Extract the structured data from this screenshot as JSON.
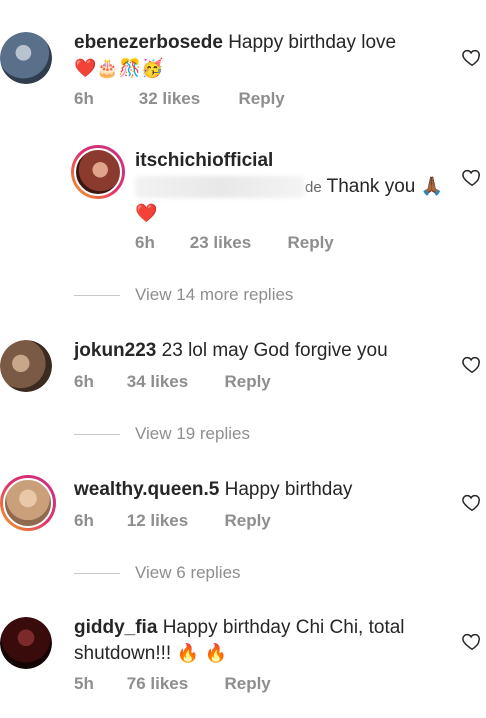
{
  "comments": [
    {
      "username": "ebenezerbosede",
      "text": "Happy birthday love",
      "emojis": "❤️🎂🎊🥳",
      "time": "6h",
      "likes": "32 likes",
      "reply": "Reply",
      "avatar_color": "#5a6f8a"
    },
    {
      "username": "itschichiofficial",
      "text_prefix": "de",
      "text": "Thank you",
      "emoji_inline": "🙏🏾",
      "emoji_line2": "❤️",
      "time": "6h",
      "likes": "23 likes",
      "reply": "Reply",
      "avatar_color": "#8a3b2e"
    },
    {
      "username": "jokun223",
      "text": "23 lol may God forgive you",
      "time": "6h",
      "likes": "34 likes",
      "reply": "Reply",
      "avatar_color": "#7a5a44"
    },
    {
      "username": "wealthy.queen.5",
      "text": "Happy birthday",
      "time": "6h",
      "likes": "12 likes",
      "reply": "Reply",
      "avatar_color": "#c9a07a"
    },
    {
      "username": "giddy_fia",
      "text": "Happy birthday Chi Chi, total shutdown!!!",
      "emojis": "🔥 🔥",
      "time": "5h",
      "likes": "76 likes",
      "reply": "Reply",
      "avatar_color": "#3a0b0b"
    }
  ],
  "view_replies": {
    "one": "View 14 more replies",
    "two": "View 19 replies",
    "three": "View 6 replies"
  },
  "icons": {
    "like": "heart-outline-icon"
  },
  "colors": {
    "text": "#262626",
    "muted": "#8e8e8e",
    "ring_start": "#f5a623",
    "ring_end": "#c13584"
  }
}
